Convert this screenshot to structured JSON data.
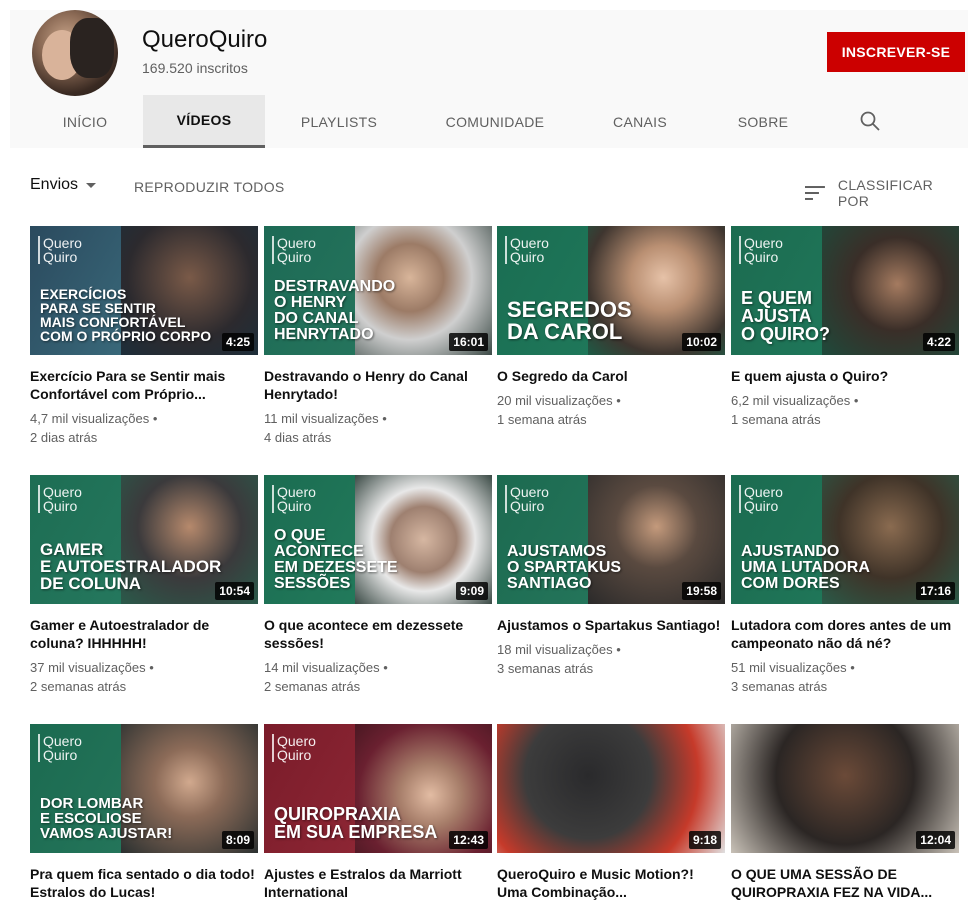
{
  "channel": {
    "name": "QueroQuiro",
    "subscribers": "169.520 inscritos",
    "subscribe_label": "INSCREVER-SE"
  },
  "tabs": [
    {
      "label": "INÍCIO"
    },
    {
      "label": "VÍDEOS",
      "active": true
    },
    {
      "label": "PLAYLISTS"
    },
    {
      "label": "COMUNIDADE"
    },
    {
      "label": "CANAIS"
    },
    {
      "label": "SOBRE"
    }
  ],
  "toolbar": {
    "sort_select": "Envios",
    "play_all": "REPRODUZIR TODOS",
    "sort_by": "CLASSIFICAR POR"
  },
  "icons": {
    "search": "search-icon",
    "sort": "sort-icon",
    "dropdown": "chevron-down-icon"
  },
  "colors": {
    "subscribe": "#cc0000",
    "thumb_green": "#1f6b4f",
    "thumb_blue": "#2c4f66"
  },
  "videos": [
    {
      "logo": "Quero\nQuiro",
      "headline": "EXERCÍCIOS\nPARA SE SENTIR\nMAIS CONFORTÁVEL\nCOM O PRÓPRIO CORPO",
      "duration": "4:25",
      "title": "Exercício Para se Sentir mais Confortável com Próprio...",
      "views": "4,7 mil visualizações •",
      "age": "2 dias atrás"
    },
    {
      "logo": "Quero\nQuiro",
      "headline": "DESTRAVANDO\nO HENRY\nDO CANAL\nHENRYTADO",
      "duration": "16:01",
      "title": "Destravando o Henry do Canal Henrytado!",
      "views": "11 mil visualizações •",
      "age": "4 dias atrás"
    },
    {
      "logo": "Quero\nQuiro",
      "headline": "SEGREDOS\nDA CAROL",
      "duration": "10:02",
      "title": "O Segredo da Carol",
      "views": "20 mil visualizações •",
      "age": "1 semana atrás"
    },
    {
      "logo": "Quero\nQuiro",
      "headline": "E QUEM\nAJUSTA\nO QUIRO?",
      "duration": "4:22",
      "title": "E quem ajusta o Quiro?",
      "views": "6,2 mil visualizações •",
      "age": "1 semana atrás"
    },
    {
      "logo": "Quero\nQuiro",
      "headline": "GAMER\nE AUTOESTRALADOR\nDE COLUNA",
      "duration": "10:54",
      "title": "Gamer e Autoestralador de coluna? IHHHHH!",
      "views": "37 mil visualizações •",
      "age": "2 semanas atrás"
    },
    {
      "logo": "Quero\nQuiro",
      "headline": "O QUE\nACONTECE\nEM DEZESSETE\nSESSÕES",
      "duration": "9:09",
      "title": "O que acontece em dezessete sessões!",
      "views": "14 mil visualizações •",
      "age": "2 semanas atrás"
    },
    {
      "logo": "Quero\nQuiro",
      "headline": "AJUSTAMOS\nO SPARTAKUS\nSANTIAGO",
      "duration": "19:58",
      "title": "Ajustamos o Spartakus Santiago!",
      "views": "18 mil visualizações •",
      "age": "3 semanas atrás"
    },
    {
      "logo": "Quero\nQuiro",
      "headline": "AJUSTANDO\nUMA LUTADORA\nCOM DORES",
      "duration": "17:16",
      "title": "Lutadora com dores antes de um campeonato não dá né?",
      "views": "51 mil visualizações •",
      "age": "3 semanas atrás"
    },
    {
      "logo": "Quero\nQuiro",
      "headline": "DOR LOMBAR\nE ESCOLIOSE\nVAMOS AJUSTAR!",
      "duration": "8:09",
      "title": "Pra quem fica sentado o dia todo! Estralos do Lucas!",
      "views": "",
      "age": ""
    },
    {
      "logo": "Quero\nQuiro",
      "headline": "QUIROPRAXIA\nEM SUA EMPRESA",
      "duration": "12:43",
      "title": "Ajustes e Estralos da Marriott International",
      "views": "",
      "age": ""
    },
    {
      "logo": "",
      "headline": "",
      "duration": "9:18",
      "title": "QueroQuiro e Music Motion?! Uma Combinação...",
      "views": "",
      "age": ""
    },
    {
      "logo": "",
      "headline": "",
      "duration": "12:04",
      "title": "O QUE UMA SESSÃO DE QUIROPRAXIA FEZ NA VIDA...",
      "views": "",
      "age": ""
    }
  ]
}
